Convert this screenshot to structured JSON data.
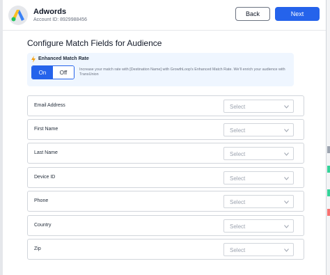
{
  "header": {
    "app_name": "Adwords",
    "account_id": "Account ID: 8929988456",
    "back_label": "Back",
    "next_label": "Next"
  },
  "page_title": "Configure Match Fields for Audience",
  "enhanced_match": {
    "label": "Enhanced Match Rate",
    "on_label": "On",
    "off_label": "Off",
    "selected": "On",
    "description": "Increase your match rate with [Destination Name] with GrowthLoop's Enhanced Match Rate. We'll enrich your audience with TransUnion"
  },
  "fields": [
    {
      "label": "Email Address",
      "select_value": "Select"
    },
    {
      "label": "First Name",
      "select_value": "Select"
    },
    {
      "label": "Last Name",
      "select_value": "Select"
    },
    {
      "label": "Device ID",
      "select_value": "Select"
    },
    {
      "label": "Phone",
      "select_value": "Select"
    },
    {
      "label": "Country",
      "select_value": "Select"
    },
    {
      "label": "Zip",
      "select_value": "Select"
    }
  ],
  "colors": {
    "primary": "#2563eb",
    "panel_bg": "#eff6ff",
    "bolt": "#f59e0b"
  }
}
